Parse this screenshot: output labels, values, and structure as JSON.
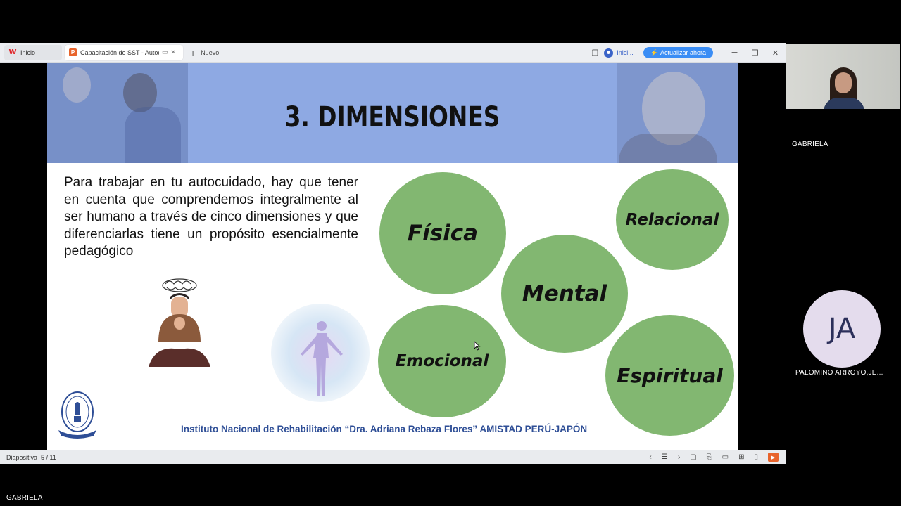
{
  "browser": {
    "tabs": [
      {
        "label": "Inicio"
      },
      {
        "label": "Capacitación de SST - Autocuidado"
      }
    ],
    "new_tab_label": "Nuevo",
    "user_label": "Inici...",
    "update_label": "Actualizar ahora"
  },
  "slide": {
    "title": "3. DIMENSIONES",
    "body": "Para trabajar en tu autocuidado, hay que tener en cuenta que comprendemos integralmente al ser humano a través de cinco dimensiones y que diferenciarlas tiene un propósito esencialmente pedagógico",
    "dimensions": [
      "Física",
      "Relacional",
      "Mental",
      "Emocional",
      "Espiritual"
    ],
    "footer": "Instituto Nacional de Rehabilitación “Dra. Adriana Rebaza Flores” AMISTAD PERÚ-JAPÓN",
    "accent_color": "#82b771",
    "banner_color": "#8ea9e3"
  },
  "statusbar": {
    "slide_label": "Diapositiva",
    "slide_position": "5 / 11"
  },
  "meeting": {
    "bottom_name": "GABRIELA",
    "participants": [
      {
        "name": "GABRIELA"
      },
      {
        "name": "PALOMINO ARROYO,JE...",
        "initials": "JA"
      }
    ]
  }
}
